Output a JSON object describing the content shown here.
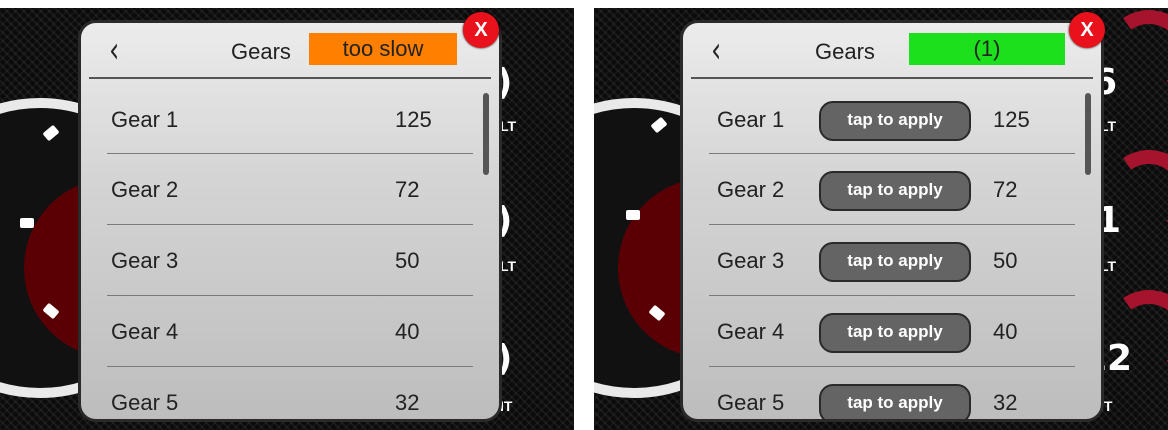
{
  "left": {
    "header": {
      "back_icon": "chevron-left-icon",
      "title": "Gears",
      "status": "too slow",
      "status_color": "#ff7f00"
    },
    "close_label": "X",
    "rows": [
      {
        "label": "Gear 1",
        "value": "125"
      },
      {
        "label": "Gear 2",
        "value": "72"
      },
      {
        "label": "Gear 3",
        "value": "50"
      },
      {
        "label": "Gear 4",
        "value": "40"
      },
      {
        "label": "Gear 5",
        "value": "32"
      }
    ],
    "background": {
      "units": [
        "LT",
        "LT",
        "IT"
      ]
    }
  },
  "right": {
    "header": {
      "back_icon": "chevron-left-icon",
      "title": "Gears",
      "status": "(1)",
      "status_color": "#1be01b"
    },
    "close_label": "X",
    "apply_label": "tap to apply",
    "rows": [
      {
        "label": "Gear 1",
        "value": "125"
      },
      {
        "label": "Gear 2",
        "value": "72"
      },
      {
        "label": "Gear 3",
        "value": "50"
      },
      {
        "label": "Gear 4",
        "value": "40"
      },
      {
        "label": "Gear 5",
        "value": "32"
      }
    ],
    "background": {
      "numbers": [
        "6",
        "1",
        "12"
      ],
      "units": [
        "LT",
        "LT",
        "IT"
      ]
    }
  },
  "colors": {
    "close": "#e8111c",
    "gauge_arc": "#a5142c"
  }
}
